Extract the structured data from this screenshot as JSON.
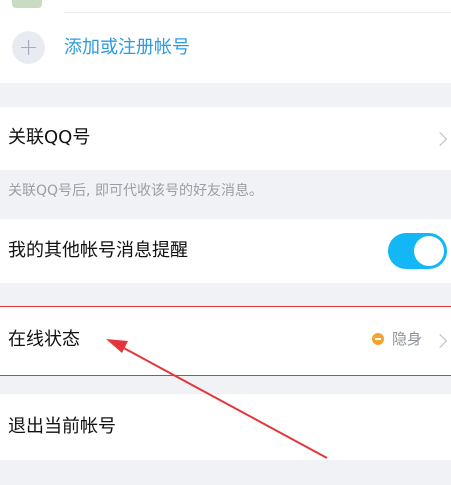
{
  "add_account": {
    "icon": "plus-icon",
    "label": "添加或注册帐号"
  },
  "link_qq": {
    "label": "关联QQ号",
    "hint": "关联QQ号后, 即可代收该号的好友消息。"
  },
  "other_account_notify": {
    "label": "我的其他帐号消息提醒",
    "toggle_on": true,
    "toggle_color": "#13b7f5"
  },
  "online_status": {
    "label": "在线状态",
    "status_icon": "invisible-status-icon",
    "status_value": "隐身",
    "status_color": "#f7a12e"
  },
  "logout": {
    "label": "退出当前帐号"
  },
  "annotation": {
    "highlight_color": "#e3363a"
  }
}
